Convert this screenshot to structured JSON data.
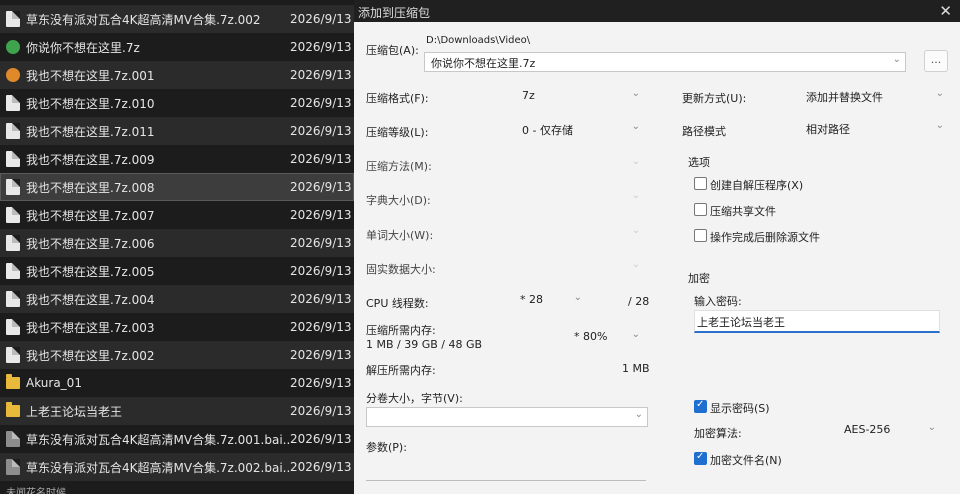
{
  "files": [
    {
      "name": "草东没有派对瓦合4K超高清MV合集.7z.002",
      "date": "2026/9/13",
      "icon": "doc-icon"
    },
    {
      "name": "你说你不想在这里.7z",
      "date": "2026/9/13",
      "icon": "green-archive-icon"
    },
    {
      "name": "我也不想在这里.7z.001",
      "date": "2026/9/13",
      "icon": "orange-archive-icon"
    },
    {
      "name": "我也不想在这里.7z.010",
      "date": "2026/9/13",
      "icon": "doc-icon"
    },
    {
      "name": "我也不想在这里.7z.011",
      "date": "2026/9/13",
      "icon": "doc-icon"
    },
    {
      "name": "我也不想在这里.7z.009",
      "date": "2026/9/13",
      "icon": "doc-icon"
    },
    {
      "name": "我也不想在这里.7z.008",
      "date": "2026/9/13",
      "icon": "doc-icon"
    },
    {
      "name": "我也不想在这里.7z.007",
      "date": "2026/9/13",
      "icon": "doc-icon"
    },
    {
      "name": "我也不想在这里.7z.006",
      "date": "2026/9/13",
      "icon": "doc-icon"
    },
    {
      "name": "我也不想在这里.7z.005",
      "date": "2026/9/13",
      "icon": "doc-icon"
    },
    {
      "name": "我也不想在这里.7z.004",
      "date": "2026/9/13",
      "icon": "doc-icon"
    },
    {
      "name": "我也不想在这里.7z.003",
      "date": "2026/9/13",
      "icon": "doc-icon"
    },
    {
      "name": "我也不想在这里.7z.002",
      "date": "2026/9/13",
      "icon": "doc-icon"
    },
    {
      "name": "Akura_01",
      "date": "2026/9/13",
      "icon": "folder-icon"
    },
    {
      "name": "上老王论坛当老王",
      "date": "2026/9/13",
      "icon": "folder-icon"
    },
    {
      "name": "草东没有派对瓦合4K超高清MV合集.7z.001.bai...",
      "date": "2026/9/13",
      "icon": "doc-icon"
    },
    {
      "name": "草东没有派对瓦合4K超高清MV合集.7z.002.bai...",
      "date": "2026/9/13",
      "icon": "doc-icon"
    }
  ],
  "status_text": "未闻花名时候",
  "dialog": {
    "title": "添加到压缩包",
    "close_glyph": "✕",
    "archive_label": "压缩包(A):",
    "archive_path": "D:\\Downloads\\Video\\",
    "archive_name": "你说你不想在这里.7z",
    "browse_label": "...",
    "format_label": "压缩格式(F):",
    "format_value": "7z",
    "level_label": "压缩等级(L):",
    "level_value": "0 - 仅存储",
    "method_label": "压缩方法(M):",
    "dict_label": "字典大小(D):",
    "word_label": "单词大小(W):",
    "solid_label": "固实数据大小:",
    "cpu_label": "CPU 线程数:",
    "cpu_value": "* 28",
    "cpu_total": "/ 28",
    "mem_label": "压缩所需内存:",
    "mem_detail": "1 MB / 39 GB / 48 GB",
    "mem_value": "* 80%",
    "decomp_label": "解压所需内存:",
    "decomp_value": "1 MB",
    "split_label": "分卷大小，字节(V):",
    "params_label": "参数(P):",
    "update_label": "更新方式(U):",
    "update_value": "添加并替换文件",
    "path_label": "路径模式",
    "path_value": "相对路径",
    "options_title": "选项",
    "opt_sfx": "创建自解压程序(X)",
    "opt_shared": "压缩共享文件",
    "opt_delete": "操作完成后删除源文件",
    "encrypt_title": "加密",
    "password_label": "输入密码:",
    "password_value": "上老王论坛当老王",
    "show_password": "显示密码(S)",
    "enc_method_label": "加密算法:",
    "enc_method_value": "AES-256",
    "encrypt_names": "加密文件名(N)"
  }
}
